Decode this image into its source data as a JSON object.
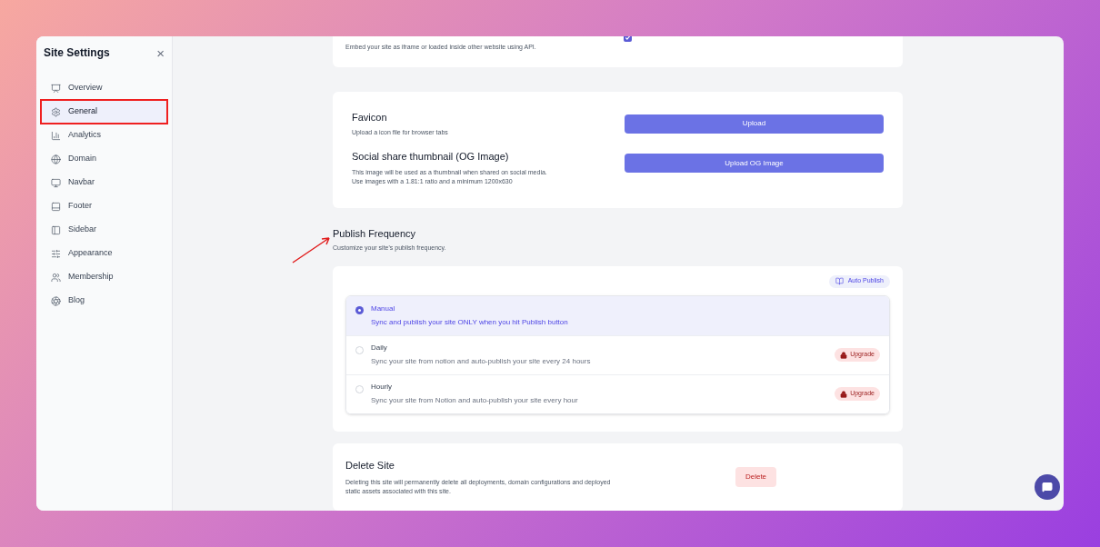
{
  "sidebar": {
    "title": "Site Settings",
    "close": "×",
    "items": [
      {
        "label": "Overview",
        "selected": false,
        "annotated": false
      },
      {
        "label": "General",
        "selected": true,
        "annotated": true
      },
      {
        "label": "Analytics",
        "selected": false,
        "annotated": false
      },
      {
        "label": "Domain",
        "selected": false,
        "annotated": false
      },
      {
        "label": "Navbar",
        "selected": false,
        "annotated": false
      },
      {
        "label": "Footer",
        "selected": false,
        "annotated": false
      },
      {
        "label": "Sidebar",
        "selected": false,
        "annotated": false
      },
      {
        "label": "Appearance",
        "selected": false,
        "annotated": false
      },
      {
        "label": "Membership",
        "selected": false,
        "annotated": false
      },
      {
        "label": "Blog",
        "selected": false,
        "annotated": false
      }
    ]
  },
  "embed": {
    "description": "Embed your site as iframe or loaded inside other website using API.",
    "checked": true
  },
  "assets": [
    {
      "title": "Favicon",
      "description": [
        "Upload a icon file for browser tabs"
      ],
      "button": "Upload"
    },
    {
      "title": "Social share thumbnail (OG Image)",
      "description": [
        "This image will be used as a thumbnail when shared on social media.",
        "Use images with a 1.81:1 ratio and a minimum 1200x630"
      ],
      "button": "Upload OG Image"
    }
  ],
  "publish": {
    "title": "Publish Frequency",
    "subtitle": "Customize your site's publish frequency.",
    "doc_link": "Auto Publish",
    "options": [
      {
        "label": "Manual",
        "description": "Sync and publish your site ONLY when you hit Publish button",
        "selected": true
      },
      {
        "label": "Daily",
        "description": "Sync your site from notion and auto-publish your site every 24 hours",
        "selected": false,
        "badge": "Upgrade"
      },
      {
        "label": "Hourly",
        "description": "Sync your site from Notion and auto-publish your site every hour",
        "selected": false,
        "badge": "Upgrade"
      }
    ]
  },
  "delete": {
    "title": "Delete Site",
    "description": "Deleting this site will permanently delete all deployments, domain configurations and deployed static assets associated with this site.",
    "button": "Delete"
  }
}
